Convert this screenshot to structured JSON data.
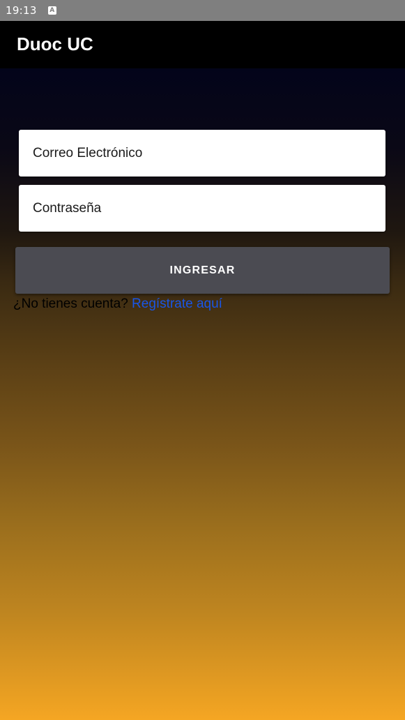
{
  "status_bar": {
    "time": "19:13",
    "icon_name": "a-notification-icon",
    "icon_letter": "A"
  },
  "app_bar": {
    "title": "Duoc UC"
  },
  "form": {
    "email_placeholder": "Correo Electrónico",
    "password_placeholder": "Contraseña",
    "login_label": "INGRESAR",
    "register_prompt": "¿No tienes cuenta?",
    "register_link": "Regístrate aquí"
  },
  "colors": {
    "app_bar": "#000000",
    "status_bar": "#7f7f7f",
    "button": "#4b4b52",
    "link": "#1a56e6",
    "gradient_top": "#03041a",
    "gradient_bottom": "#f5a623"
  }
}
